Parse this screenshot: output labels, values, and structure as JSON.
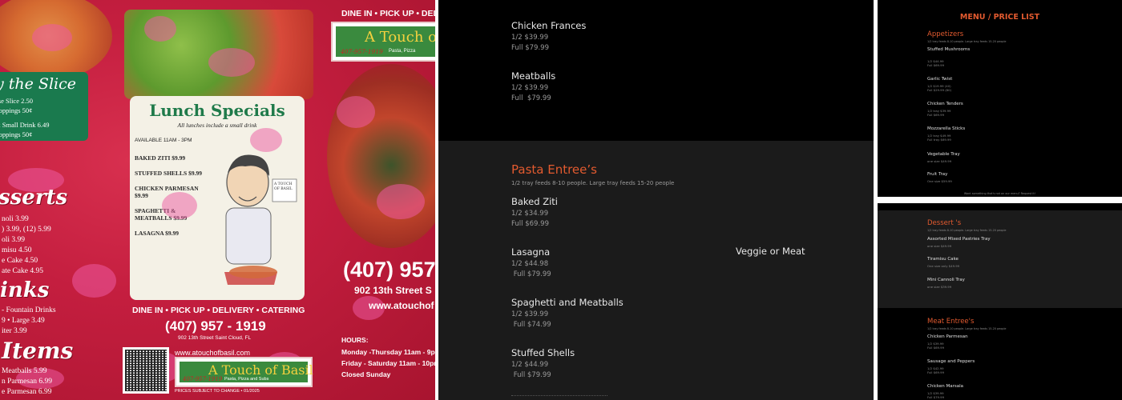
{
  "flyer": {
    "by_the_slice": {
      "title": "y the Slice",
      "lines": [
        "ese Slice 2.50",
        "Toppings 50¢",
        "& Small Drink 6.49",
        "Toppings 50¢"
      ]
    },
    "desserts": {
      "title": "sserts",
      "lines": [
        "noli 3.99",
        ") 3.99, (12) 5.99",
        "oli 3.99",
        "misu 4.50",
        "e Cake 4.50",
        "ate Cake 4.95"
      ]
    },
    "drinks": {
      "title": "inks",
      "lines": [
        "- Fountain Drinks",
        "9 • Large 3.49",
        "iter 3.99"
      ]
    },
    "items": {
      "title": "Items",
      "lines": [
        "Meatballs 5.99",
        "n Parmesan 6.99",
        "e Parmesan 6.99"
      ]
    },
    "lunch": {
      "title": "Lunch Specials",
      "subtitle": "All lunches include a small drink",
      "available": "AVAILABLE 11AM - 3PM",
      "items": [
        "BAKED ZITI $9.99",
        "STUFFED SHELLS $9.99",
        "CHICKEN PARMESAN $9.99",
        "SPAGHETTI & MEATBALLS $9.99",
        "LASAGNA $9.99"
      ],
      "sign": "A TOUCH OF BASIL"
    },
    "services": "DINE IN • PICK UP • DELIVERY • CATERING",
    "phone": "(407) 957 - 1919",
    "address": "902 13th Street Saint Cloud, FL",
    "website": "www.atouchofbasil.com",
    "logo_name": "A Touch of Basil",
    "logo_tag": "Pasta, Pizza and Subs",
    "logo_phone": "407-957-1919",
    "prices_note": "PRICES SUBJECT TO CHANGE • 01/2025",
    "right_strip": "DINE IN • PICK UP • DEL",
    "right_logo_name": "A Touch o",
    "right_logo_tag": "Pasta, Pizza",
    "right_phone": "(407) 957",
    "right_address": "902 13th Street S",
    "right_website": "www.atouchof",
    "hours_title": "HOURS:",
    "hours": [
      "Monday -Thursday 11am - 9pm",
      "Friday - Saturday 11am - 10pm",
      "Closed Sunday"
    ]
  },
  "main_menu": {
    "top_items": [
      {
        "name": "Chicken Frances",
        "price": "1/2 $39.99\nFull $79.99"
      },
      {
        "name": "Meatballs",
        "price": "1/2 $39.99\nFull  $79.99"
      }
    ],
    "pasta": {
      "title": "Pasta Entree’s",
      "note": "1/2 tray feeds 8-10 people. Large tray feeds 15-20 people",
      "items": [
        {
          "name": "Baked Ziti",
          "price": "1/2 $34.99\nFull $69.99"
        },
        {
          "name": "Lasagna",
          "price": "1/2 $44.98\n Full $79.99"
        },
        {
          "name": "Spaghetti and Meatballs",
          "price": "1/2 $39.99\n Full $74.99"
        },
        {
          "name": "Stuffed Shells",
          "price": "1/2 $44.99\n Full $79.99"
        }
      ],
      "side_note": "Veggie or Meat"
    }
  },
  "price_list": {
    "title": "MENU / PRICE LIST",
    "appetizers": {
      "title": "Appetizers",
      "note": "1/2 tray feeds 8-10 people. Large tray feeds 15-20 people",
      "items": [
        {
          "name": "Stuffed Mushrooms",
          "price": "1/2 $44.99\nFull $69.99"
        },
        {
          "name": "Garlic Twist",
          "price": "1/2 $19.99 (40)\nFull $29.99 (80)"
        },
        {
          "name": "Chicken Tenders",
          "price": "1/2 tray $39.99\nFull $69.99"
        },
        {
          "name": "Mozzarella Sticks",
          "price": "1/2 tray $49.99\nFull tray $69.99"
        },
        {
          "name": "Vegetable Tray",
          "price": "one size $49.99"
        },
        {
          "name": "Fruit Tray",
          "price": "One size $59.99"
        }
      ],
      "footer": "Want something that's not on our menu? Request it!"
    },
    "desserts": {
      "title": "Dessert 's",
      "note": "1/2 tray feeds 8-10 people. Large tray feeds 15-20 people",
      "items": [
        {
          "name": "Assorted Mixed Pastries Tray",
          "price": "one size $49.99"
        },
        {
          "name": "Tiramisu Cake",
          "price": "One size only $49.99"
        },
        {
          "name": "Mini Cannoli Tray",
          "price": "one size $39.99"
        }
      ]
    },
    "meat": {
      "title": "Meat Entree's",
      "note": "1/2 tray feeds 8-10 people. Large tray feeds 15-20 people",
      "items": [
        {
          "name": "Chicken Parmesan",
          "price": "1/2 $39.99\nFull $69.99"
        },
        {
          "name": "Sausage and Peppers",
          "price": "1/2 $42.99\nFull $69.99"
        },
        {
          "name": "Chicken Marsala",
          "price": "1/2 $39.99\nFull $79.99"
        }
      ]
    }
  },
  "colors": {
    "flyer_red": "#c41e3f",
    "pink_overlay": "#ec5aa0",
    "basil_green": "#1f7a4a",
    "accent_orange": "#e25a2f"
  }
}
